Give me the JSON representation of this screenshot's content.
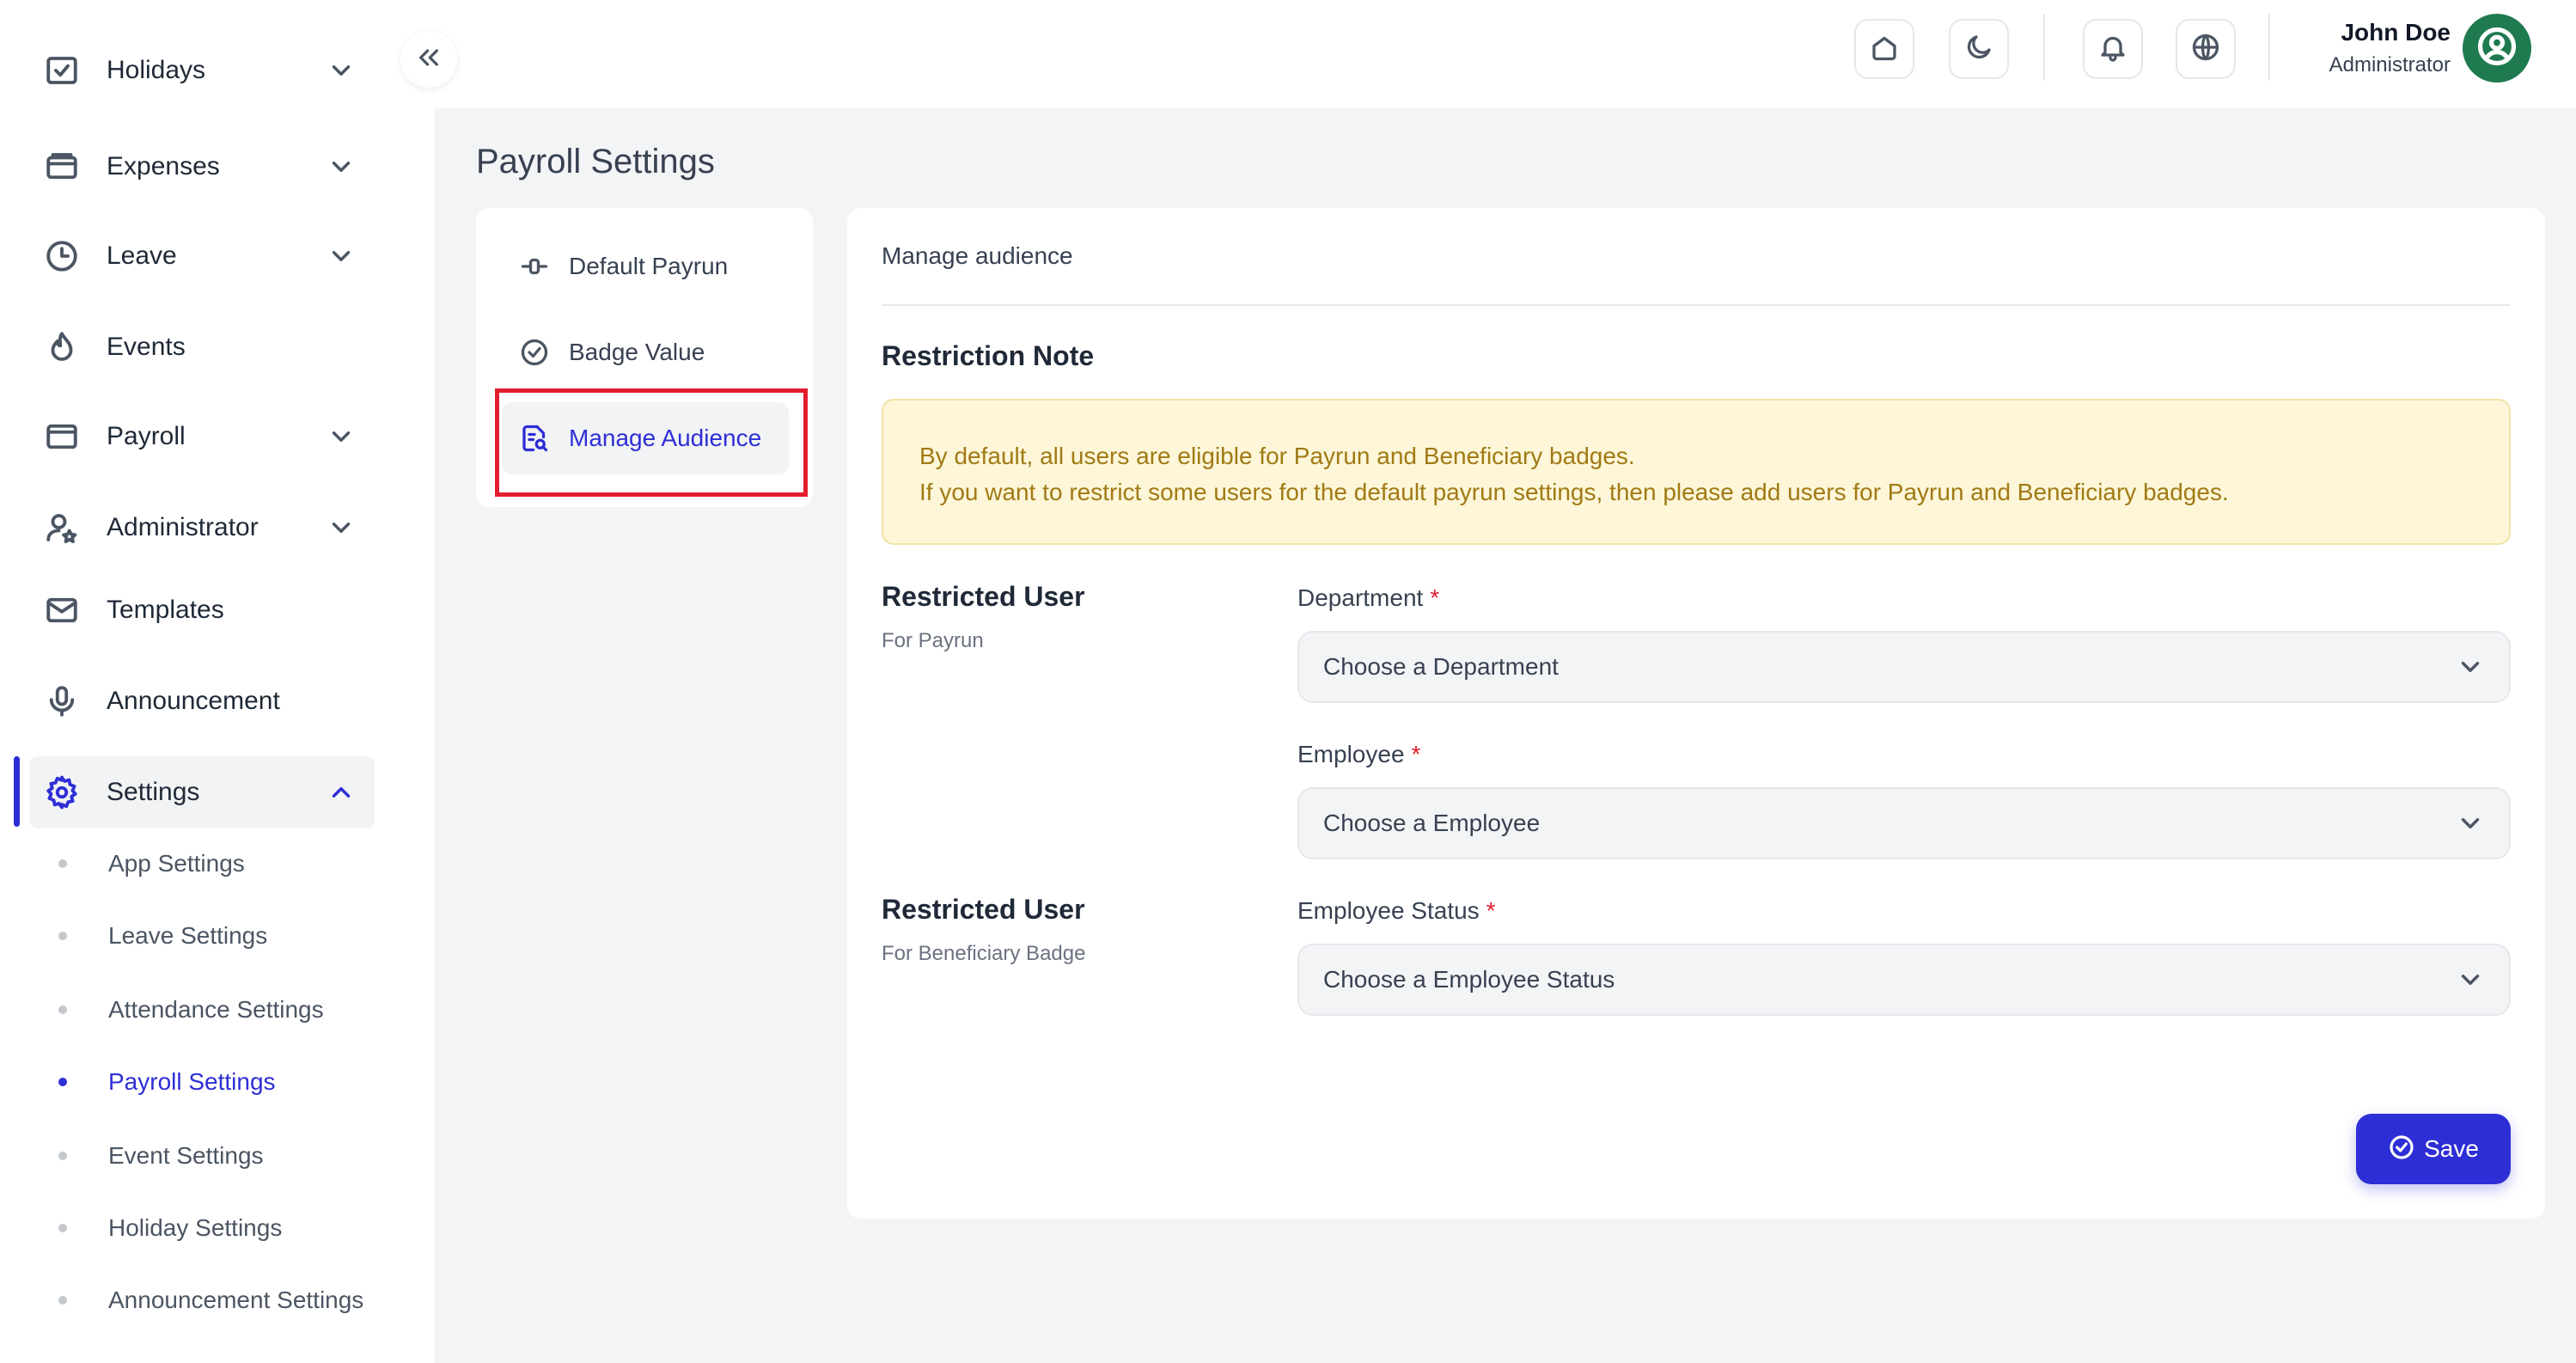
{
  "sidebar": {
    "items": [
      {
        "label": "Holidays",
        "icon": "calendar-check-icon",
        "has_chevron": true
      },
      {
        "label": "Expenses",
        "icon": "wallet-icon",
        "has_chevron": true
      },
      {
        "label": "Leave",
        "icon": "clock-icon",
        "has_chevron": true
      },
      {
        "label": "Events",
        "icon": "flame-icon",
        "has_chevron": false
      },
      {
        "label": "Payroll",
        "icon": "card-icon",
        "has_chevron": true
      },
      {
        "label": "Administrator",
        "icon": "user-star-icon",
        "has_chevron": true
      },
      {
        "label": "Templates",
        "icon": "envelope-icon",
        "has_chevron": false
      },
      {
        "label": "Announcement",
        "icon": "microphone-icon",
        "has_chevron": false
      },
      {
        "label": "Settings",
        "icon": "gear-icon",
        "has_chevron": true,
        "expanded": true
      }
    ],
    "settings_sub": [
      {
        "label": "App Settings"
      },
      {
        "label": "Leave Settings"
      },
      {
        "label": "Attendance Settings"
      },
      {
        "label": "Payroll Settings",
        "current": true
      },
      {
        "label": "Event Settings"
      },
      {
        "label": "Holiday Settings"
      },
      {
        "label": "Announcement Settings"
      }
    ]
  },
  "header": {
    "user_name": "John Doe",
    "user_role": "Administrator",
    "icons": [
      "home-icon",
      "moon-icon",
      "bell-icon",
      "globe-icon"
    ]
  },
  "page": {
    "title": "Payroll Settings"
  },
  "tabs": [
    {
      "label": "Default Payrun",
      "icon": "toggle-icon"
    },
    {
      "label": "Badge Value",
      "icon": "check-circle-icon"
    },
    {
      "label": "Manage Audience",
      "icon": "document-search-icon",
      "selected": true
    }
  ],
  "main": {
    "card_title": "Manage audience",
    "restriction_title": "Restriction Note",
    "note_line1": "By default, all users are eligible for Payrun and Beneficiary badges.",
    "note_line2": "If you want to restrict some users for the default payrun settings, then please add users for Payrun and Beneficiary badges.",
    "ru1_title": "Restricted User",
    "ru1_sub": "For Payrun",
    "ru2_title": "Restricted User",
    "ru2_sub": "For Beneficiary Badge",
    "department_label": "Department",
    "department_placeholder": "Choose a Department",
    "employee_label": "Employee",
    "employee_placeholder": "Choose a Employee",
    "status_label": "Employee Status",
    "status_placeholder": "Choose a Employee Status",
    "required_mark": "*",
    "save_label": "Save"
  },
  "colors": {
    "accent": "#2e2ed6",
    "note_bg": "#fdf6d8",
    "note_text": "#a07a14",
    "highlight": "#e11d2e",
    "avatar": "#1f7a4f"
  }
}
